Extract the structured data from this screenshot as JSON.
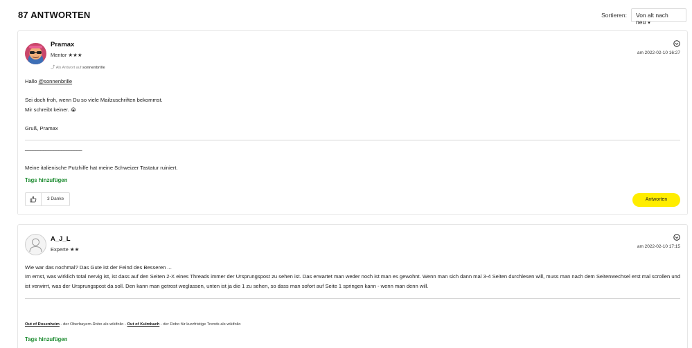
{
  "header": {
    "replies_count": "87 ANTWORTEN",
    "sort_label": "Sortieren:",
    "sort_value": "Von alt nach neu"
  },
  "posts": [
    {
      "author": "Pramax",
      "rank": "Mentor ★★★",
      "reply_to_prefix": "Als Antwort auf",
      "reply_to_user": "sonnenbrille",
      "timestamp": "am 2022-02-10 16:27",
      "greeting": "Hallo",
      "mention": "@sonnenbrille",
      "body_line1": "Sei doch froh, wenn Du so viele Mailzuschriften bekommst.",
      "body_line2": "Mir schreibt keiner.",
      "body_emoji": "😭",
      "closing": "Gruß, Pramax",
      "signature_rule": "______________________",
      "signature": "Meine italienische Putzhilfe hat meine Schweizer Tastatur ruiniert.",
      "tags_link": "Tags hinzufügen",
      "thanks_count": "3 Danke",
      "reply_button": "Antworten"
    },
    {
      "author": "A_J_L",
      "rank": "Experte ★★",
      "timestamp": "am 2022-02-10 17:15",
      "body_line1": "Wie war das nochmal? Das Gute ist der Feind des Besseren ...",
      "body_line2": "Im ernst, was wirklich total nervig ist, ist dass auf den Seiten 2-X eines Threads immer der Ursprungspost zu sehen ist. Das erwartet man weder noch ist man es gewohnt. Wenn man sich dann mal 3-4 Seiten durchlesen will, muss man nach dem Seitenwechsel erst mal scrollen und ist verwirrt, was der Ursprungspost da soll. Den kann man getrost weglassen, unten ist ja die 1 zu sehen, so dass man sofort auf Seite 1 springen kann - wenn man denn will.",
      "sig_link1": "Out of Rosenheim",
      "sig_text1": " - der Oberbayern-Robo als wikifolio - ",
      "sig_link2": "Out of Kulmbach",
      "sig_text2": " - der Robo für kurzfristige Trends als wikifolio",
      "tags_link": "Tags hinzufügen"
    }
  ],
  "colors": {
    "accent_yellow": "#ffed00",
    "tags_green": "#1a8a2e"
  },
  "icons": {
    "sort_caret": "▾",
    "post_menu": "chevron-circle-down-icon",
    "like": "thumbs-up-icon",
    "reply_arrow": "reply-arrow-icon"
  }
}
